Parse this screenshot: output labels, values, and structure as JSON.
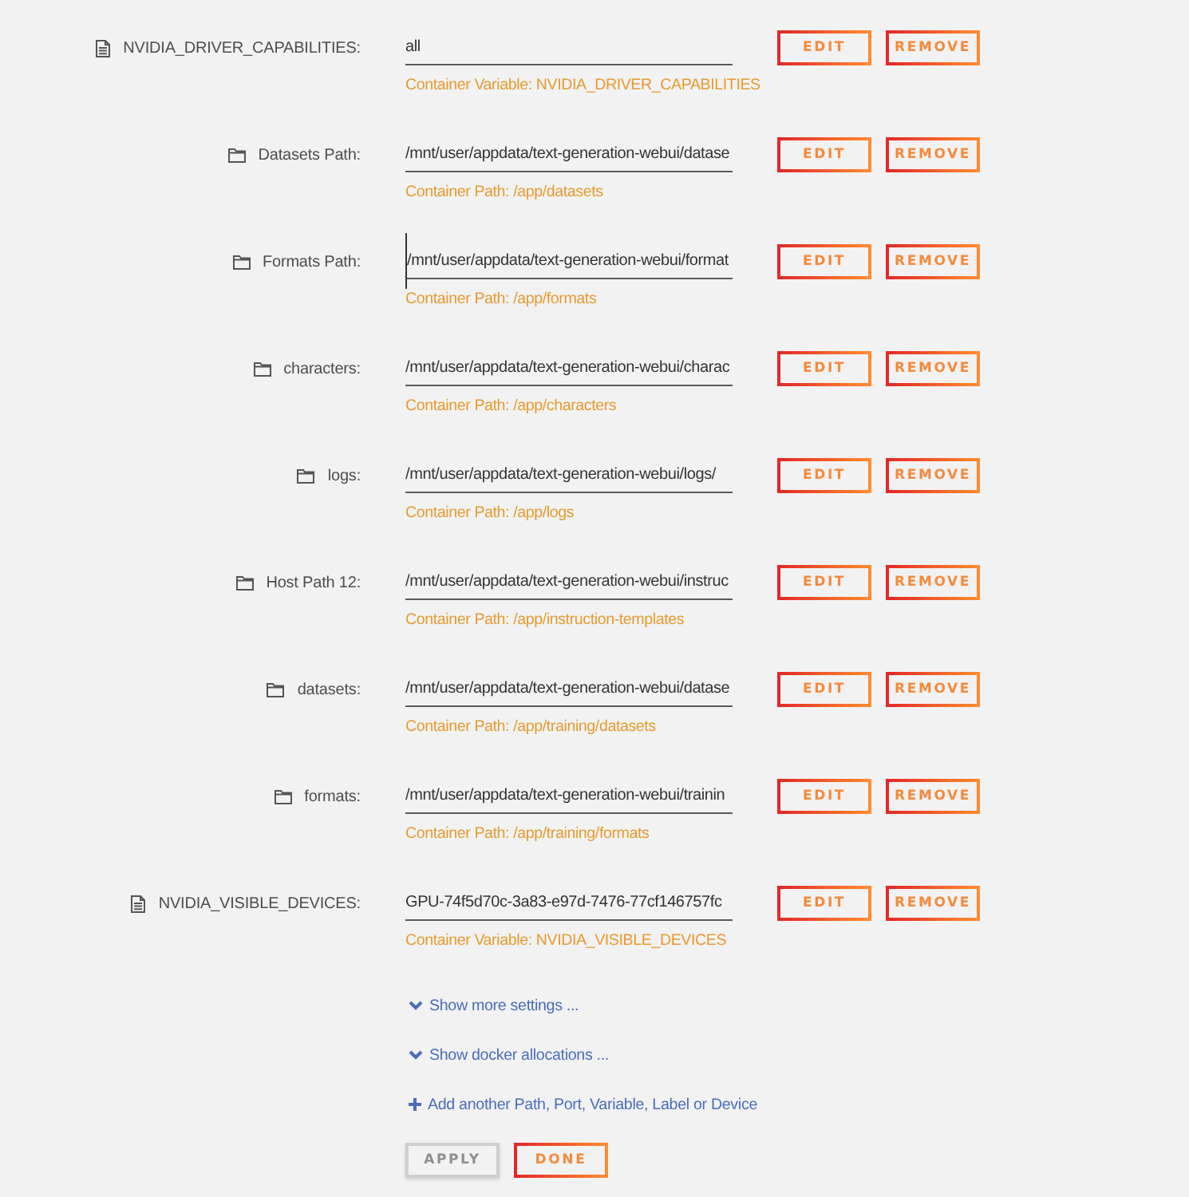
{
  "entries": [
    {
      "kind": "variable",
      "label": "NVIDIA_DRIVER_CAPABILITIES:",
      "value": "all",
      "note": "Container Variable: NVIDIA_DRIVER_CAPABILITIES",
      "text_cursor": false,
      "buttons": [
        "EDIT",
        "REMOVE"
      ]
    },
    {
      "kind": "path",
      "label": "Datasets Path:",
      "value": "/mnt/user/appdata/text-generation-webui/datase",
      "note": "Container Path: /app/datasets",
      "text_cursor": false,
      "buttons": [
        "EDIT",
        "REMOVE"
      ]
    },
    {
      "kind": "path",
      "label": "Formats Path:",
      "value": "/mnt/user/appdata/text-generation-webui/format",
      "note": "Container Path: /app/formats",
      "text_cursor": true,
      "buttons": [
        "EDIT",
        "REMOVE"
      ]
    },
    {
      "kind": "path",
      "label": "characters:",
      "value": "/mnt/user/appdata/text-generation-webui/charac",
      "note": "Container Path: /app/characters",
      "text_cursor": false,
      "buttons": [
        "EDIT",
        "REMOVE"
      ]
    },
    {
      "kind": "path",
      "label": "logs:",
      "value": "/mnt/user/appdata/text-generation-webui/logs/",
      "note": "Container Path: /app/logs",
      "text_cursor": false,
      "buttons": [
        "EDIT",
        "REMOVE"
      ]
    },
    {
      "kind": "path",
      "label": "Host Path 12:",
      "value": "/mnt/user/appdata/text-generation-webui/instruc",
      "note": "Container Path: /app/instruction-templates",
      "text_cursor": false,
      "buttons": [
        "EDIT",
        "REMOVE"
      ]
    },
    {
      "kind": "path",
      "label": "datasets:",
      "value": "/mnt/user/appdata/text-generation-webui/datase",
      "note": "Container Path: /app/training/datasets",
      "text_cursor": false,
      "buttons": [
        "EDIT",
        "REMOVE"
      ]
    },
    {
      "kind": "path",
      "label": "formats:",
      "value": "/mnt/user/appdata/text-generation-webui/trainin",
      "note": "Container Path: /app/training/formats",
      "text_cursor": false,
      "buttons": [
        "EDIT",
        "REMOVE"
      ]
    },
    {
      "kind": "variable",
      "label": "NVIDIA_VISIBLE_DEVICES:",
      "value": "GPU-74f5d70c-3a83-e97d-7476-77cf146757fc",
      "note": "Container Variable: NVIDIA_VISIBLE_DEVICES",
      "text_cursor": false,
      "buttons": [
        "EDIT",
        "REMOVE"
      ]
    }
  ],
  "links": [
    {
      "kind": "expand",
      "text": "Show more settings ..."
    },
    {
      "kind": "expand",
      "text": "Show docker allocations ..."
    },
    {
      "kind": "add",
      "text": "Add another Path, Port, Variable, Label or Device"
    }
  ],
  "actions": [
    {
      "label": "APPLY",
      "disabled": true
    },
    {
      "label": "DONE",
      "disabled": false
    }
  ]
}
